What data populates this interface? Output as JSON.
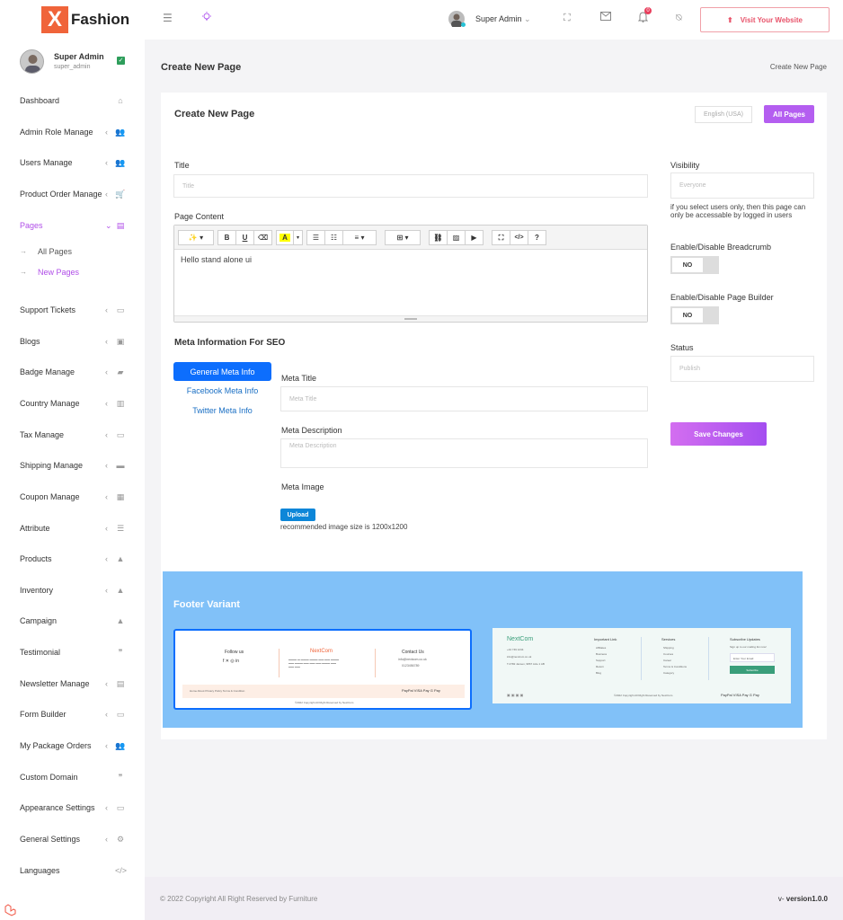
{
  "brand": {
    "logo_letter": "X",
    "name": "Fashion",
    "accent": "#f0643a",
    "primary": "#b45ef0"
  },
  "sidebar": {
    "user_name": "Super Admin",
    "user_role": "super_admin",
    "items": [
      {
        "label": "Dashboard",
        "icon": "home-icon",
        "glyph": "⌂",
        "chev": ""
      },
      {
        "label": "Admin Role Manage",
        "icon": "users-icon",
        "glyph": "👥",
        "chev": "‹"
      },
      {
        "label": "Users Manage",
        "icon": "users-icon",
        "glyph": "👥",
        "chev": "‹"
      },
      {
        "label": "Product Order Manage",
        "icon": "cart-icon",
        "glyph": "🛒",
        "chev": "‹"
      },
      {
        "label": "Pages",
        "icon": "file-icon",
        "glyph": "▤",
        "chev": "⌄"
      },
      {
        "label": "Support Tickets",
        "icon": "folder-icon",
        "glyph": "▭",
        "chev": "‹"
      },
      {
        "label": "Blogs",
        "icon": "blog-icon",
        "glyph": "▣",
        "chev": "‹"
      },
      {
        "label": "Badge Manage",
        "icon": "tag-icon",
        "glyph": "▰",
        "chev": "‹"
      },
      {
        "label": "Country Manage",
        "icon": "map-icon",
        "glyph": "▥",
        "chev": "‹"
      },
      {
        "label": "Tax Manage",
        "icon": "money-icon",
        "glyph": "▭",
        "chev": "‹"
      },
      {
        "label": "Shipping Manage",
        "icon": "truck-icon",
        "glyph": "▬",
        "chev": "‹"
      },
      {
        "label": "Coupon Manage",
        "icon": "coupon-icon",
        "glyph": "▦",
        "chev": "‹"
      },
      {
        "label": "Attribute",
        "icon": "list-icon",
        "glyph": "☰",
        "chev": "‹"
      },
      {
        "label": "Products",
        "icon": "bag-icon",
        "glyph": "▲",
        "chev": "‹"
      },
      {
        "label": "Inventory",
        "icon": "bag-icon",
        "glyph": "▲",
        "chev": "‹"
      },
      {
        "label": "Campaign",
        "icon": "bag-icon",
        "glyph": "▲",
        "chev": ""
      },
      {
        "label": "Testimonial",
        "icon": "quote-icon",
        "glyph": "❞",
        "chev": ""
      },
      {
        "label": "Newsletter Manage",
        "icon": "newsletter-icon",
        "glyph": "▤",
        "chev": "‹"
      },
      {
        "label": "Form Builder",
        "icon": "folder-icon",
        "glyph": "▭",
        "chev": "‹"
      },
      {
        "label": "My Package Orders",
        "icon": "users-icon",
        "glyph": "👥",
        "chev": "‹"
      },
      {
        "label": "Custom Domain",
        "icon": "quote-icon",
        "glyph": "❞",
        "chev": ""
      },
      {
        "label": "Appearance Settings",
        "icon": "folder-icon",
        "glyph": "▭",
        "chev": "‹"
      },
      {
        "label": "General Settings",
        "icon": "gear-icon",
        "glyph": "⚙",
        "chev": "‹"
      },
      {
        "label": "Languages",
        "icon": "code-icon",
        "glyph": "</>",
        "chev": ""
      }
    ],
    "sub_items": [
      {
        "label": "All Pages"
      },
      {
        "label": "New Pages"
      }
    ]
  },
  "topbar": {
    "user_name": "Super Admin",
    "notification_count": "0",
    "visit_label": "Visit Your Website"
  },
  "page": {
    "header_title": "Create New Page",
    "breadcrumb": "Create New Page",
    "card_title": "Create New Page",
    "language": "English (USA)",
    "all_pages_label": "All Pages",
    "title_label": "Title",
    "title_placeholder": "Title",
    "content_label": "Page Content",
    "content_value": "Hello stand alone ui",
    "visibility_label": "Visibility",
    "visibility_placeholder": "Everyone",
    "visibility_hint": "if you select users only, then this page can only be accessable by logged in users",
    "breadcrumb_toggle_label": "Enable/Disable Breadcrumb",
    "breadcrumb_toggle_value": "NO",
    "builder_toggle_label": "Enable/Disable Page Builder",
    "builder_toggle_value": "NO",
    "status_label": "Status",
    "status_placeholder": "Publish",
    "save_label": "Save Changes"
  },
  "seo": {
    "title": "Meta Information For SEO",
    "tabs": [
      "General Meta Info",
      "Facebook Meta Info",
      "Twitter Meta Info"
    ],
    "meta_title_label": "Meta Title",
    "meta_title_placeholder": "Meta Title",
    "meta_desc_label": "Meta Description",
    "meta_desc_placeholder": "Meta Description",
    "meta_image_label": "Meta Image",
    "upload_label": "Upload",
    "image_hint": "recommended image size is 1200x1200"
  },
  "footer_variant": {
    "title": "Footer Variant",
    "v1": {
      "follow": "Follow us",
      "brand": "NextCom",
      "contact": "Contact Us",
      "email": "info@nextcom.co.uk",
      "phone": "0123456789",
      "links": "Home   About   Privacy Policy   Terms & Condition",
      "payments": "PayPal   VISA   Pay   G Pay",
      "copyright": "©2022 Copyright All Right Reserved by NextCom"
    },
    "v2": {
      "brand": "NextCom",
      "phone": "+44 749 1234",
      "email": "info@nextcom.co.uk",
      "address": "T-3782 Jansen, 9867 Axle 1 AB",
      "col1": "Important Link",
      "col1_items": [
        "Affiliates",
        "Business",
        "Support",
        "Return",
        "Blog"
      ],
      "col2": "Services",
      "col2_items": [
        "Shipping",
        "Courses",
        "Career",
        "Terms & Conditions",
        "Category"
      ],
      "col3": "Subscribe Updates",
      "col3_text": "Sign up to our mailing list now!",
      "col3_input": "Enter Your Email",
      "col3_btn": "Subscribe",
      "copyright": "©2022 Copyright All Right Reserved by NextCom",
      "payments": "PayPal   VISA   Pay   G Pay"
    }
  },
  "footer": {
    "copyright": "© 2022 Copyright All Right Reserved by Furniture",
    "version_prefix": "v-",
    "version": "version1.0.0"
  }
}
